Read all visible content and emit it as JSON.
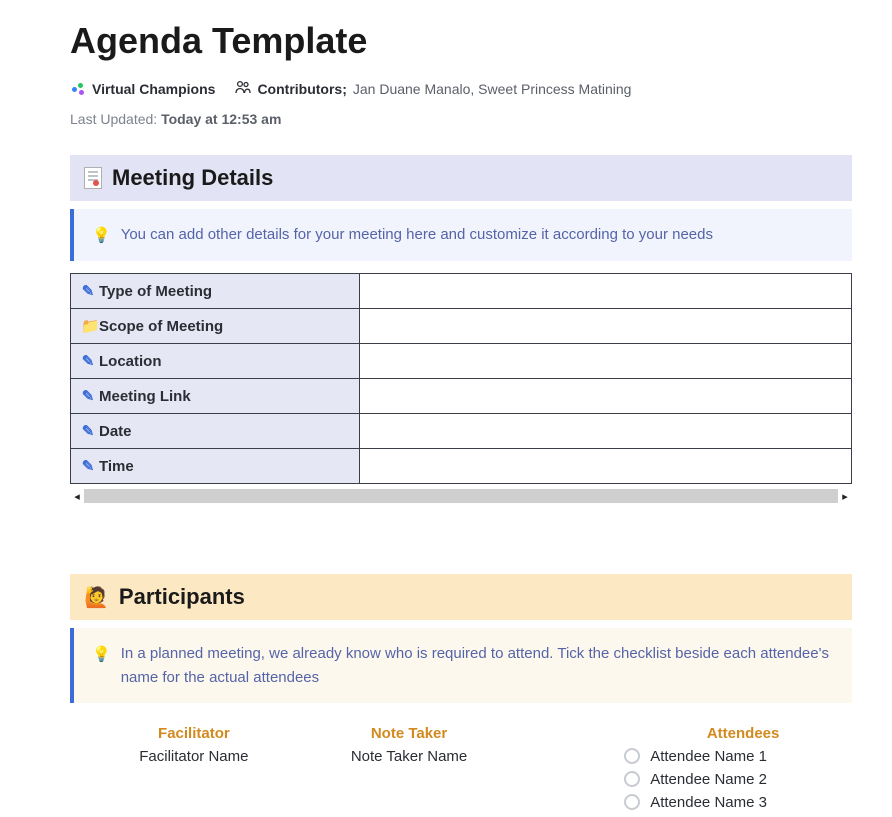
{
  "title": "Agenda Template",
  "team": {
    "name": "Virtual Champions"
  },
  "contributors": {
    "label": "Contributors",
    "names": "Jan Duane Manalo, Sweet Princess Matining"
  },
  "last_updated": {
    "prefix": "Last Updated: ",
    "value": "Today at 12:53 am"
  },
  "sections": {
    "meeting_details": {
      "heading": "Meeting Details",
      "callout": "You can add other details for your meeting here and customize it according to your needs",
      "rows": [
        {
          "icon": "pencil",
          "label": "Type of Meeting",
          "value": ""
        },
        {
          "icon": "folder",
          "label": "Scope of Meeting",
          "value": ""
        },
        {
          "icon": "pencil",
          "label": "Location",
          "value": ""
        },
        {
          "icon": "pencil",
          "label": "Meeting Link",
          "value": ""
        },
        {
          "icon": "pencil",
          "label": "Date",
          "value": ""
        },
        {
          "icon": "pencil",
          "label": "Time",
          "value": ""
        }
      ]
    },
    "participants": {
      "heading": "Participants",
      "callout": "In a planned meeting, we already know who is required to attend. Tick the checklist beside each attendee's name for the actual attendees",
      "roles": {
        "facilitator": {
          "label": "Facilitator",
          "name": "Facilitator Name"
        },
        "note_taker": {
          "label": "Note Taker",
          "name": "Note Taker Name"
        },
        "attendees": {
          "label": "Attendees",
          "list": [
            "Attendee Name 1",
            "Attendee Name 2",
            "Attendee Name 3"
          ]
        }
      }
    }
  }
}
